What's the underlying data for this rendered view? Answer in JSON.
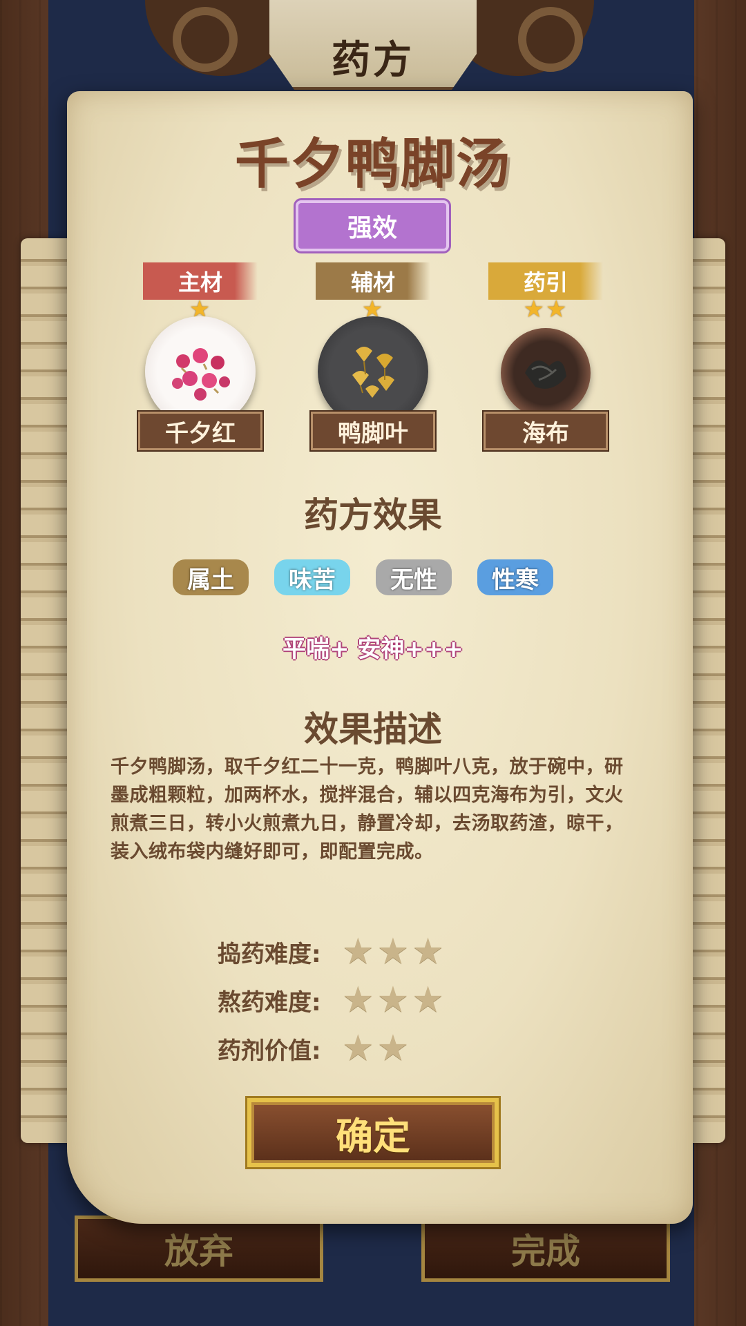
{
  "header": {
    "title": "药方"
  },
  "recipe": {
    "name": "千夕鸭脚汤",
    "potency": "强效",
    "ingredients": [
      {
        "role": "主材",
        "stars": "★",
        "name": "千夕红",
        "role_color": "#c85a50",
        "plate_color": "#f2ecea",
        "icon": "red-flower-buds"
      },
      {
        "role": "辅材",
        "stars": "★",
        "name": "鸭脚叶",
        "role_color": "#9c7a48",
        "plate_color": "#3c3c3e",
        "icon": "ginkgo-leaves"
      },
      {
        "role": "药引",
        "stars": "★★",
        "name": "海布",
        "role_color": "#d9a93a",
        "plate_color": "#6e4a3a",
        "icon": "kelp"
      }
    ]
  },
  "effects": {
    "heading": "药方效果",
    "properties": [
      {
        "label": "属土",
        "color": "#a8884c"
      },
      {
        "label": "味苦",
        "color": "#78d4ec"
      },
      {
        "label": "无性",
        "color": "#a9a9a9"
      },
      {
        "label": "性寒",
        "color": "#5a9ee0"
      }
    ],
    "effect_text": "平喘+ 安神+++"
  },
  "description": {
    "heading": "效果描述",
    "text": "千夕鸭脚汤，取千夕红二十一克，鸭脚叶八克，放于碗中，研墨成粗颗粒，加两杯水，搅拌混合，辅以四克海布为引，文火煎煮三日，转小火煎煮九日，静置冷却，去汤取药渣，晾干，装入绒布袋内缝好即可，即配置完成。"
  },
  "ratings": [
    {
      "label": "捣药难度:",
      "stars": "★★★",
      "value": 3
    },
    {
      "label": "熬药难度:",
      "stars": "★★★",
      "value": 3
    },
    {
      "label": "药剂价值:",
      "stars": "★★",
      "value": 2
    }
  ],
  "buttons": {
    "confirm": "确定",
    "abandon": "放弃",
    "complete": "完成"
  }
}
